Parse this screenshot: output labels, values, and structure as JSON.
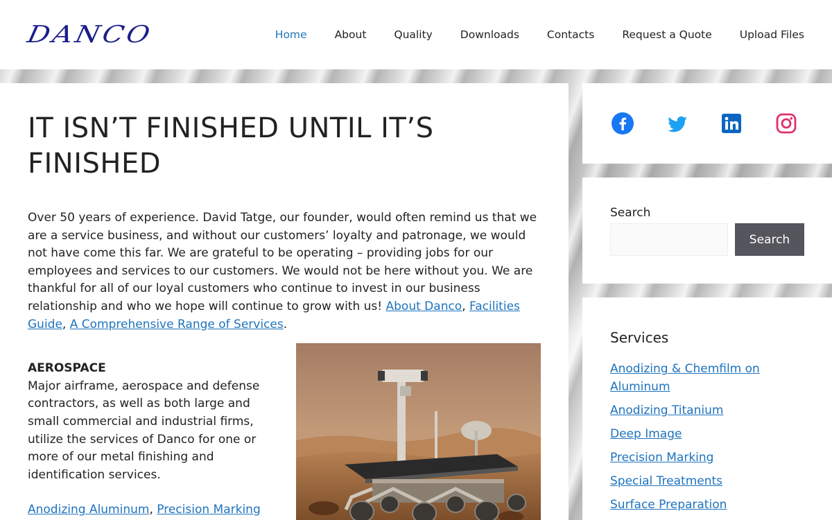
{
  "logo": {
    "text": "DANCO"
  },
  "nav": {
    "items": [
      {
        "label": "Home",
        "active": true
      },
      {
        "label": "About"
      },
      {
        "label": "Quality"
      },
      {
        "label": "Downloads"
      },
      {
        "label": "Contacts"
      },
      {
        "label": "Request a Quote"
      },
      {
        "label": "Upload Files"
      }
    ]
  },
  "content": {
    "title": "IT ISN’T FINISHED UNTIL IT’S FINISHED",
    "intro": "Over 50 years of experience. David Tatge, our founder, would often remind us that we are a service business, and without our customers’ loyalty and patronage, we would not have come this far.  We are grateful to be operating – providing jobs for our employees and services to our customers.  We would not be here without you.  We are thankful for all of our loyal customers who continue to invest in our business relationship and who we hope will continue to grow with us!",
    "intro_links": [
      "About Danco",
      "Facilities Guide",
      "A Comprehensive Range of Services"
    ],
    "aerospace": {
      "heading": "AEROSPACE",
      "body": "Major airframe, aerospace and defense contractors, as well as both large and small commercial and industrial firms, utilize the services of Danco for one or more of our metal finishing and identification services.",
      "links": [
        "Anodizing Aluminum",
        "Precision Marking"
      ]
    }
  },
  "social": {
    "facebook_color": "#1877f2",
    "twitter_color": "#1da1f2",
    "linkedin_color": "#0a66c2",
    "instagram_color": "#e1306c"
  },
  "search": {
    "label": "Search",
    "input_value": "",
    "button_label": "Search"
  },
  "services": {
    "title": "Services",
    "items": [
      "Anodizing & Chemfilm on Aluminum",
      "Anodizing Titanium",
      "Deep Image",
      "Precision Marking",
      "Special Treatments",
      "Surface Preparation"
    ]
  }
}
